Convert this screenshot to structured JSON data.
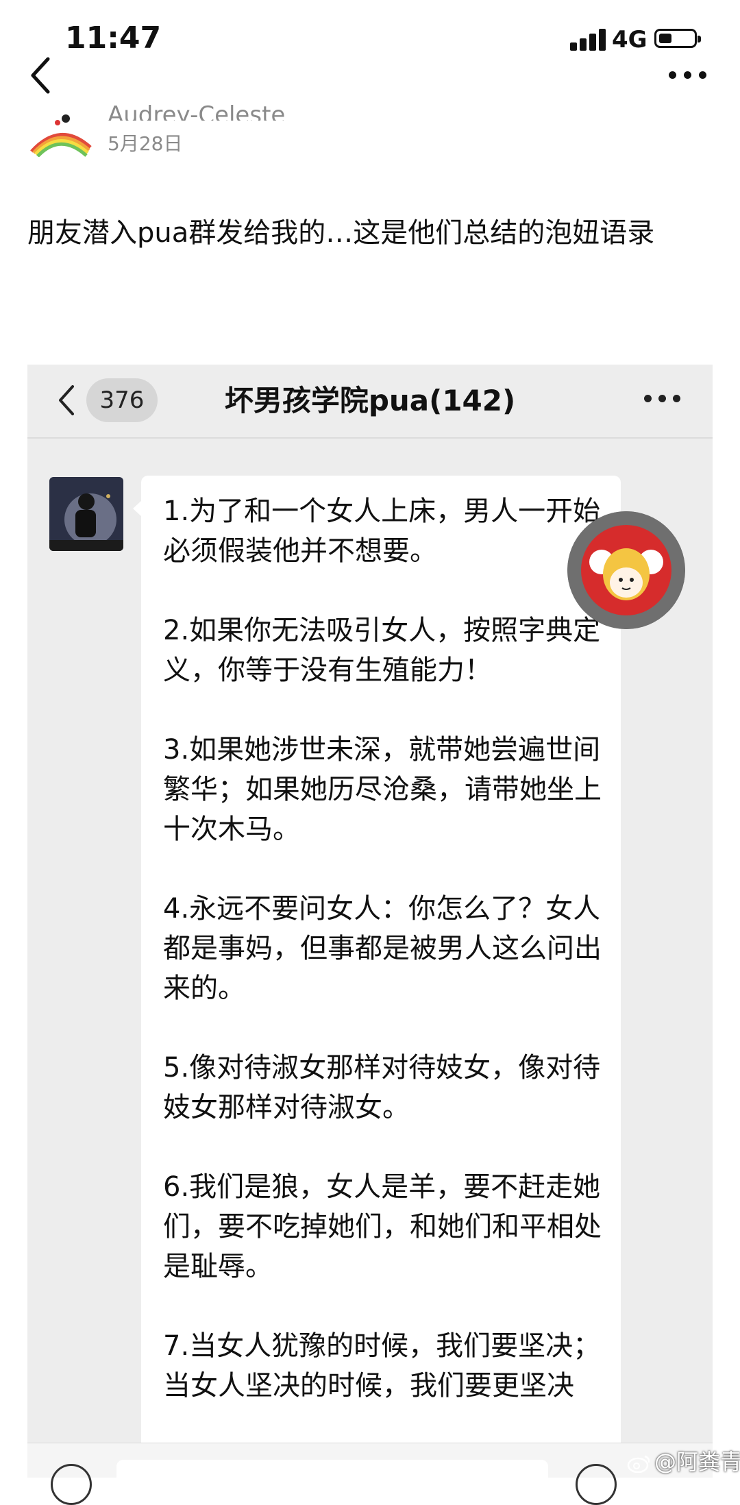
{
  "status_bar": {
    "time": "11:47",
    "network": "4G"
  },
  "post": {
    "author": "Audrey-Celeste",
    "date": "5月28日",
    "text": "朋友潜入pua群发给我的…这是他们总结的泡妞语录"
  },
  "chat": {
    "unread_badge": "376",
    "group_title": "坏男孩学院pua(142)",
    "messages": [
      "1.为了和一个女人上床，男人一开始必须假装他并不想要。",
      "2.如果你无法吸引女人，按照字典定义，你等于没有生殖能力！",
      "3.如果她涉世未深，就带她尝遍世间繁华；如果她历尽沧桑，请带她坐上十次木马。",
      "4.永远不要问女人：你怎么了？女人都是事妈，但事都是被男人这么问出来的。",
      "5.像对待淑女那样对待妓女，像对待妓女那样对待淑女。",
      "6.我们是狼，女人是羊，要不赶走她们，要不吃掉她们，和她们和平相处是耻辱。",
      "7.当女人犹豫的时候，我们要坚决；当女人坚决的时候，我们要更坚决"
    ]
  },
  "watermark": "@阿粪青",
  "icons": [
    "signal-icon",
    "battery-icon",
    "back-chevron-icon",
    "more-dots-icon",
    "weibo-logo-icon"
  ]
}
